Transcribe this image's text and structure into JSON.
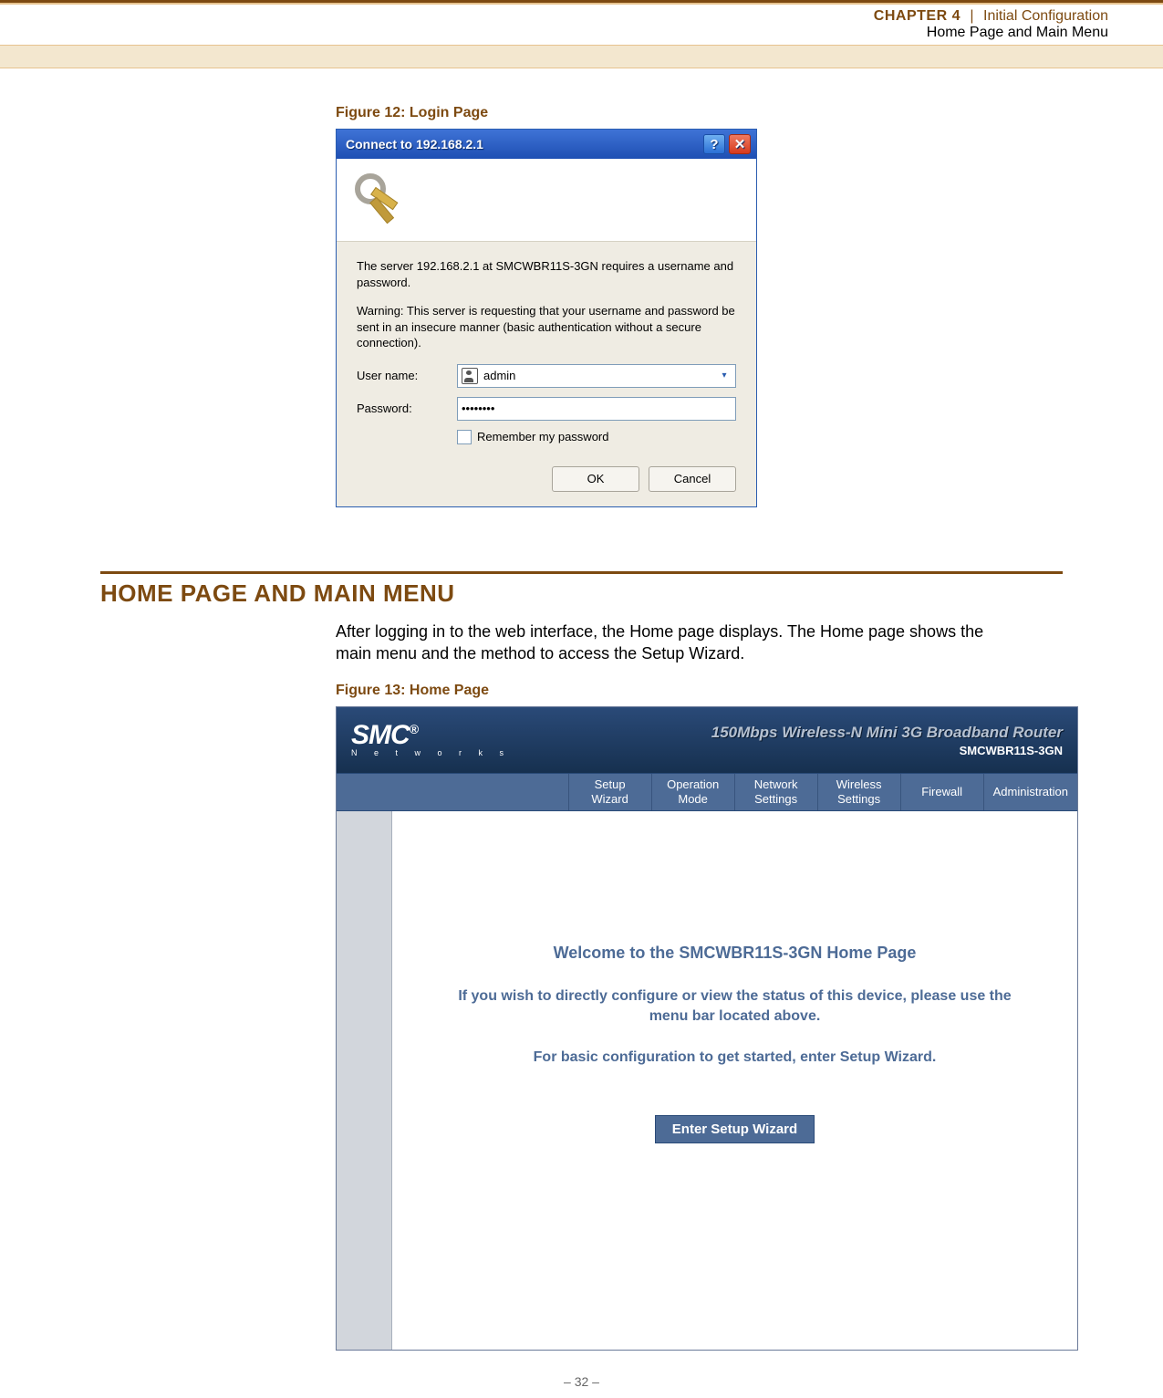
{
  "header": {
    "chapter": "CHAPTER 4",
    "sep": "|",
    "title": "Initial Configuration",
    "subtitle": "Home Page and Main Menu"
  },
  "figure12": {
    "caption": "Figure 12:  Login Page",
    "dialog": {
      "title": "Connect to 192.168.2.1",
      "server_text": "The server 192.168.2.1 at SMCWBR11S-3GN requires a username and password.",
      "warning_text": "Warning: This server is requesting that your username and password be sent in an insecure manner (basic authentication without a secure connection).",
      "user_label": "User name:",
      "user_value": "admin",
      "pass_label": "Password:",
      "pass_value": "••••••••",
      "remember": "Remember my password",
      "ok": "OK",
      "cancel": "Cancel"
    }
  },
  "section": {
    "title": "HOME PAGE AND MAIN MENU",
    "para": "After logging in to the web interface, the Home page displays. The Home page shows the main menu and the method to access the Setup Wizard."
  },
  "figure13": {
    "caption": "Figure 13:  Home Page",
    "home": {
      "logo": "SMC",
      "logo_sub": "N e t w o r k s",
      "prod_title": "150Mbps Wireless-N Mini 3G Broadband Router",
      "prod_model": "SMCWBR11S-3GN",
      "nav": [
        "Setup\nWizard",
        "Operation\nMode",
        "Network\nSettings",
        "Wireless\nSettings",
        "Firewall",
        "Administration"
      ],
      "welcome": "Welcome to the SMCWBR11S-3GN Home Page",
      "line1": "If you wish to directly configure or view the status of this device, please use the menu bar located above.",
      "line2": "For basic configuration to get started, enter Setup Wizard.",
      "enter_btn": "Enter Setup Wizard"
    }
  },
  "footer": {
    "page_num": "–  32  –"
  }
}
